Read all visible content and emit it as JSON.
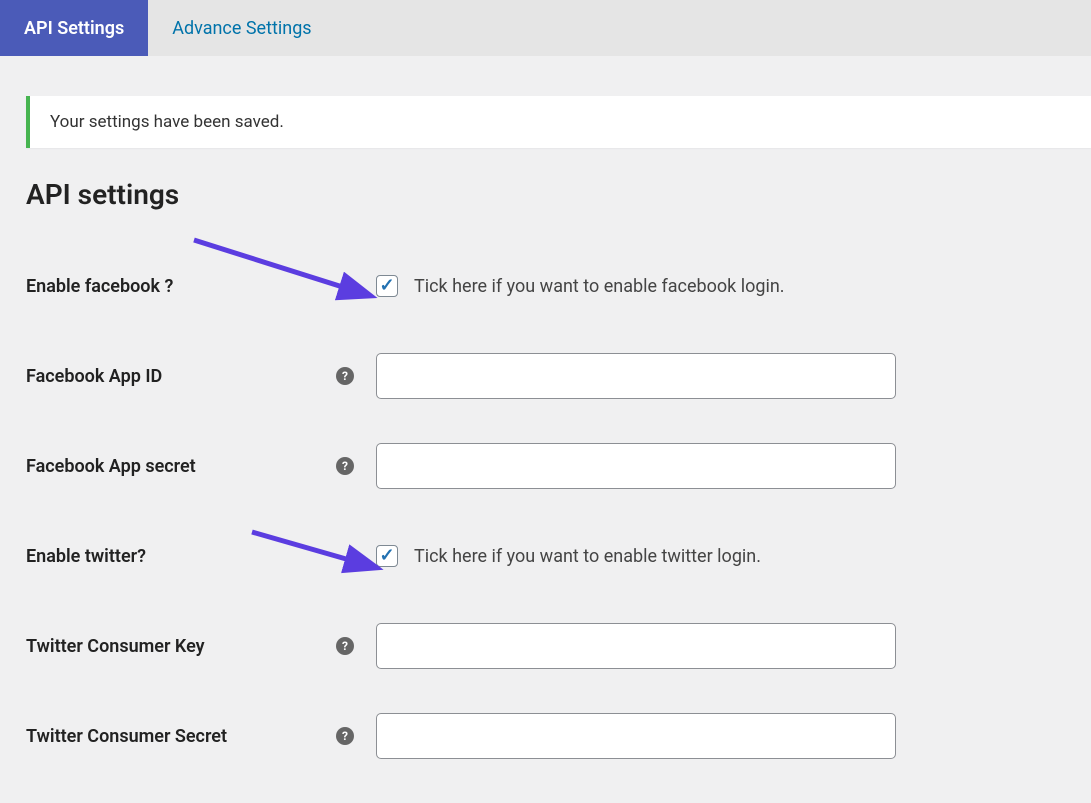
{
  "tabs": {
    "api_settings": "API Settings",
    "advance_settings": "Advance Settings"
  },
  "notice": "Your settings have been saved.",
  "section_title": "API settings",
  "fields": {
    "enable_facebook": {
      "label": "Enable facebook ?",
      "description": "Tick here if you want to enable facebook login.",
      "checked": true
    },
    "facebook_app_id": {
      "label": "Facebook App ID",
      "value": ""
    },
    "facebook_app_secret": {
      "label": "Facebook App secret",
      "value": ""
    },
    "enable_twitter": {
      "label": "Enable twitter?",
      "description": "Tick here if you want to enable twitter login.",
      "checked": true
    },
    "twitter_consumer_key": {
      "label": "Twitter Consumer Key",
      "value": ""
    },
    "twitter_consumer_secret": {
      "label": "Twitter Consumer Secret",
      "value": ""
    }
  },
  "colors": {
    "tab_active_bg": "#4b5bb8",
    "link": "#0073aa",
    "success": "#46b450",
    "arrow": "#5b3de0"
  }
}
